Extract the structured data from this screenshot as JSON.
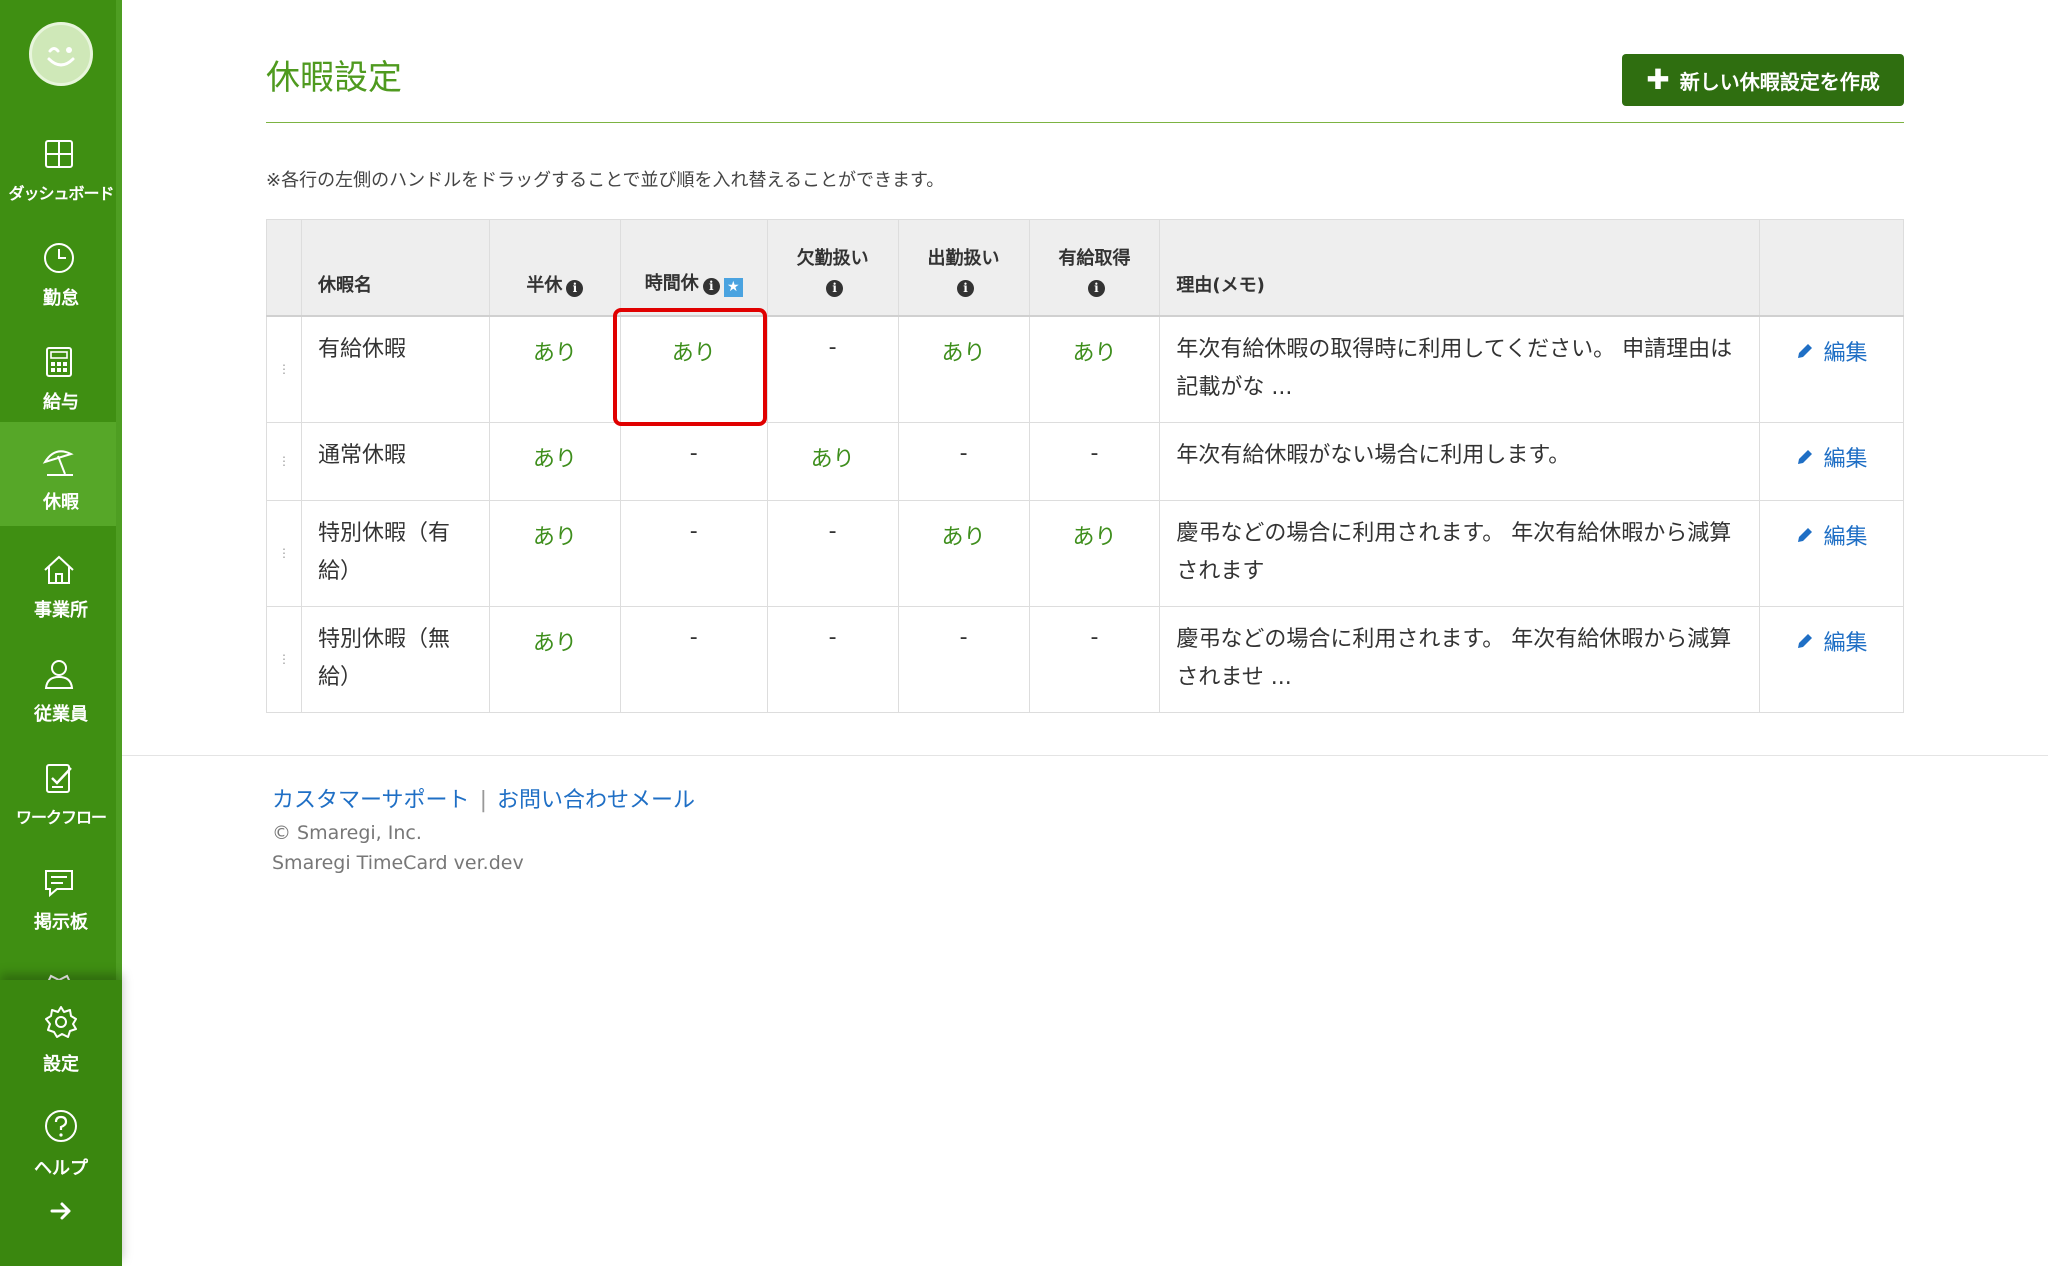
{
  "sidebar": {
    "items": [
      {
        "label": "ダッシュボード",
        "icon": "dashboard-icon",
        "active": false
      },
      {
        "label": "勤怠",
        "icon": "clock-icon",
        "active": false
      },
      {
        "label": "給与",
        "icon": "calculator-icon",
        "active": false
      },
      {
        "label": "休暇",
        "icon": "beach-umbrella-icon",
        "active": true
      },
      {
        "label": "事業所",
        "icon": "home-icon",
        "active": false
      },
      {
        "label": "従業員",
        "icon": "user-icon",
        "active": false
      },
      {
        "label": "ワークフロー",
        "icon": "clipboard-check-icon",
        "active": false
      },
      {
        "label": "掲示板",
        "icon": "chat-icon",
        "active": false
      }
    ],
    "bottom": [
      {
        "label": "設定",
        "icon": "gear-icon"
      },
      {
        "label": "ヘルプ",
        "icon": "question-icon"
      }
    ],
    "colors": {
      "background": "#3f8f12",
      "active": "#56a728"
    }
  },
  "header": {
    "title": "休暇設定",
    "create_button": "新しい休暇設定を作成"
  },
  "hint": "※各行の左側のハンドルをドラッグすることで並び順を入れ替えることができます。",
  "table": {
    "columns": {
      "name": "休暇名",
      "half": "半休",
      "hourly": "時間休",
      "absence_1": "欠勤扱",
      "absence_2": "い",
      "attendance_1": "出勤扱",
      "attendance_2": "い",
      "paid_1": "有給取",
      "paid_2": "得",
      "memo": "理由(メモ)"
    },
    "rows": [
      {
        "name": "有給休暇",
        "half": "あり",
        "hourly": "あり",
        "absence": "-",
        "attendance": "あり",
        "paid": "あり",
        "memo": "年次有給休暇の取得時に利用してください。 申請理由は記載がな ...",
        "edit": "編集"
      },
      {
        "name": "通常休暇",
        "half": "あり",
        "hourly": "-",
        "absence": "あり",
        "attendance": "-",
        "paid": "-",
        "memo": "年次有給休暇がない場合に利用します。",
        "edit": "編集"
      },
      {
        "name": "特別休暇（有給）",
        "half": "あり",
        "hourly": "-",
        "absence": "-",
        "attendance": "あり",
        "paid": "あり",
        "memo": "慶弔などの場合に利用されます。 年次有給休暇から減算されます",
        "edit": "編集"
      },
      {
        "name": "特別休暇（無給）",
        "half": "あり",
        "hourly": "-",
        "absence": "-",
        "attendance": "-",
        "paid": "-",
        "memo": "慶弔などの場合に利用されます。 年次有給休暇から減算されませ ...",
        "edit": "編集"
      }
    ]
  },
  "footer": {
    "support_link": "カスタマーサポート",
    "separator": "|",
    "contact_link": "お問い合わせメール",
    "copyright": "© Smaregi, Inc.",
    "version": "Smaregi TimeCard ver.dev"
  }
}
